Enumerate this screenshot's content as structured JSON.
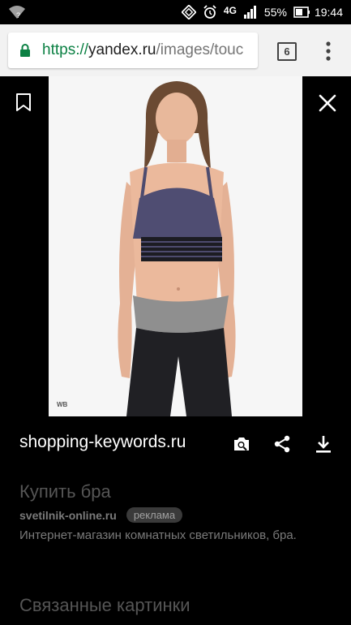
{
  "status_bar": {
    "network": "4G",
    "battery": "55%",
    "time": "19:44",
    "wifi_mark": "?"
  },
  "url_bar": {
    "scheme": "https",
    "separator": "://",
    "host": "yandex.ru",
    "path": "/images/touc",
    "tab_count": "6"
  },
  "image_viewer": {
    "watermark": "WB",
    "source_domain": "shopping-keywords.ru"
  },
  "ad": {
    "title": "Купить бра",
    "site": "svetilnik-online.ru",
    "badge": "реклама",
    "description": "Интернет-магазин комнатных светильников, бра."
  },
  "related": {
    "heading": "Связанные картинки"
  },
  "colors": {
    "secure_green": "#0b8043",
    "background": "#000000"
  }
}
